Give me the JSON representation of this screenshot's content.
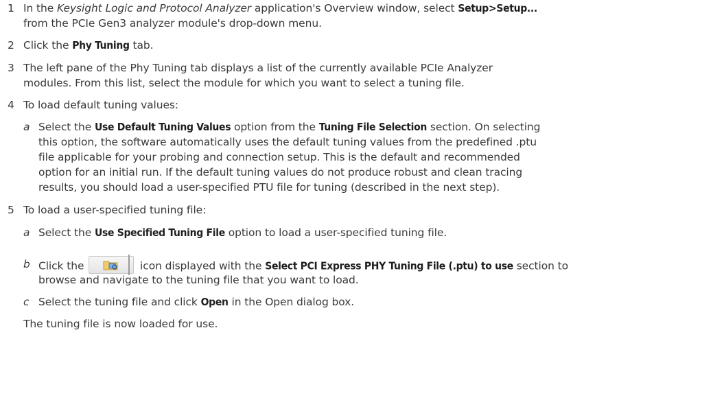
{
  "steps": [
    {
      "number": "1",
      "l1_a": "In the ",
      "l1_app": "Keysight Logic and Protocol Analyzer",
      "l1_b": " application's Overview window, select ",
      "l1_bold": "Setup>Setup...",
      "l2": "from the PCIe Gen3 analyzer module's drop-down menu."
    },
    {
      "number": "2",
      "a": "Click the ",
      "bold": "Phy Tuning",
      "b": " tab."
    },
    {
      "number": "3",
      "l1": "The left pane of the Phy Tuning tab displays a list of the currently available PCIe Analyzer",
      "l2": "modules. From this list, select the module for which you want to select a tuning file."
    },
    {
      "number": "4",
      "text": "To load default tuning values:",
      "sub": {
        "letter": "a",
        "l1_a": "Select the ",
        "l1_bold1": "Use Default Tuning Values",
        "l1_b": " option from the ",
        "l1_bold2": "Tuning File Selection",
        "l1_c": " section. On selecting",
        "l2": "this option, the software automatically uses the default tuning values from the predefined .ptu",
        "l3": "file applicable for your probing and connection setup. This is the default and recommended",
        "l4": "option for an initial run. If the default tuning values do not produce robust and clean tracing",
        "l5": "results, you should load a user-specified PTU file for tuning (described in the next step)."
      }
    },
    {
      "number": "5",
      "text": "To load a user-specified tuning file:",
      "sub_a": {
        "letter": "a",
        "pre": "Select the ",
        "bold": "Use Specified Tuning File",
        "post": " option to load a user-specified tuning file."
      },
      "sub_b": {
        "letter": "b",
        "pre": "Click the ",
        "mid": " icon displayed with the ",
        "bold": "Select PCI Express PHY Tuning File (.ptu) to use",
        "post": " section to",
        "l2": "browse and navigate to the tuning file that you want to load."
      },
      "sub_c": {
        "letter": "c",
        "pre": "Select the tuning file and click ",
        "bold": "Open",
        "post": " in the Open dialog box."
      }
    }
  ],
  "closing": "The tuning file is now loaded for use.",
  "icon": "browse-folder-icon"
}
